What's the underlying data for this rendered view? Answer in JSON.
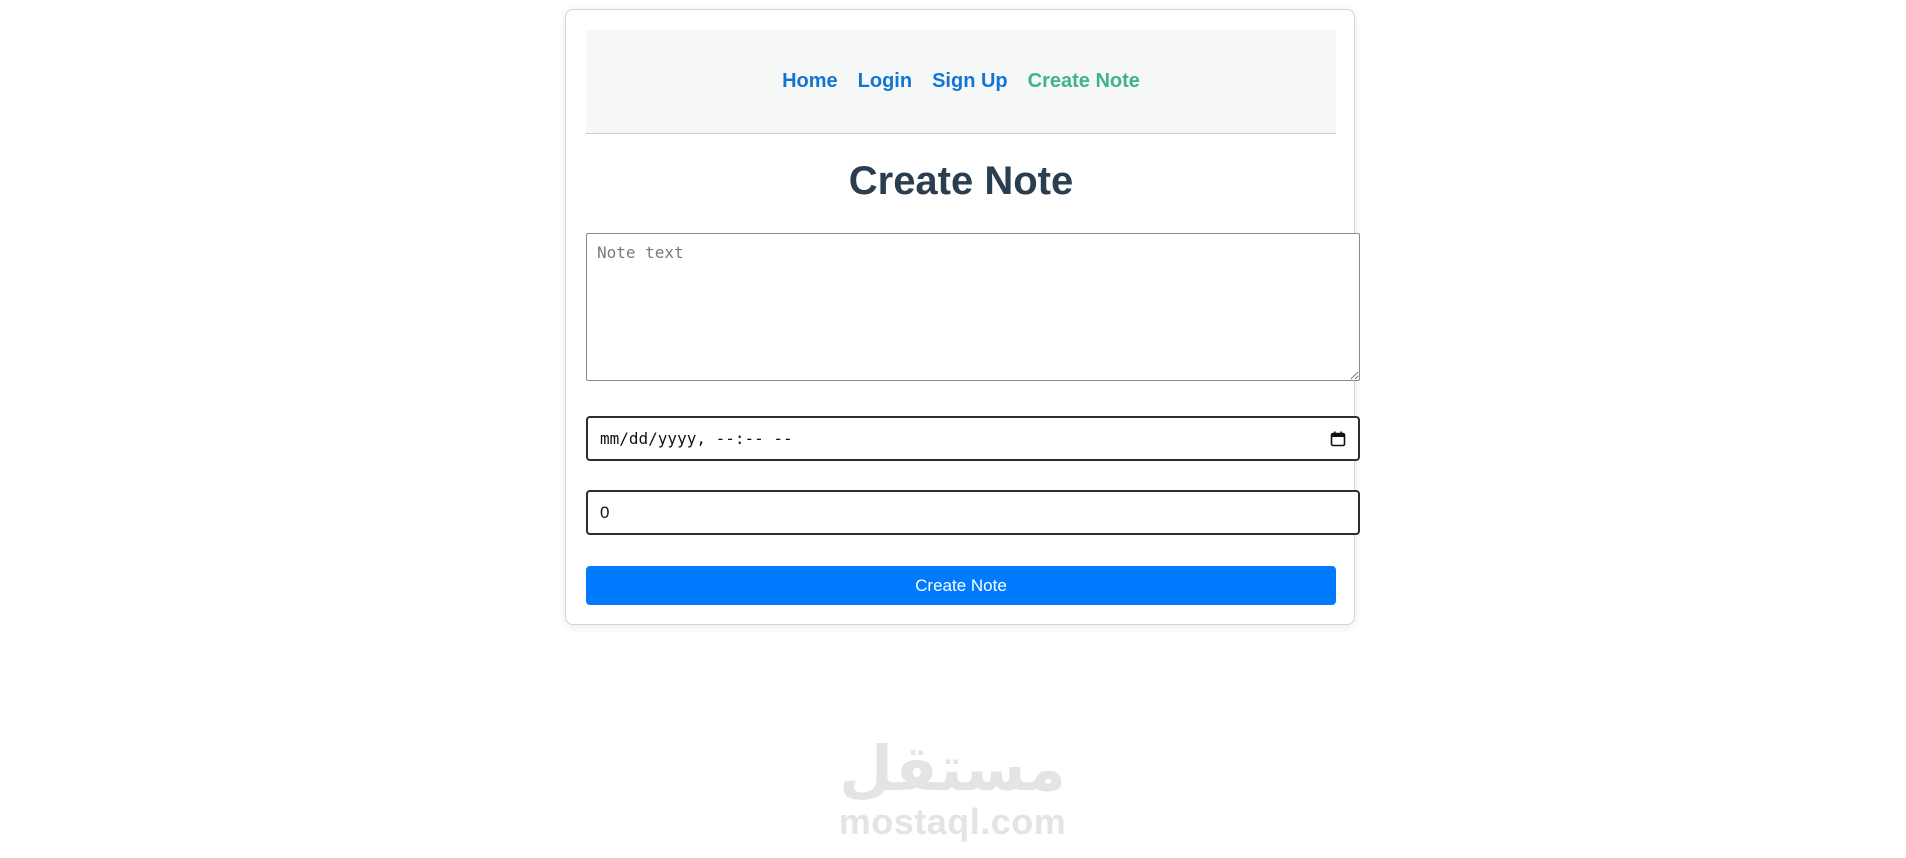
{
  "nav": {
    "items": [
      {
        "label": "Home",
        "active": false
      },
      {
        "label": "Login",
        "active": false
      },
      {
        "label": "Sign Up",
        "active": false
      },
      {
        "label": "Create Note",
        "active": true
      }
    ]
  },
  "page": {
    "title": "Create Note"
  },
  "form": {
    "note_placeholder": "Note text",
    "note_value": "",
    "datetime_value": "mm/dd/yyyy, --:-- --",
    "number_value": "0",
    "submit_label": "Create Note"
  },
  "watermark": {
    "arabic": "مستقل",
    "latin": "mostaql.com"
  },
  "colors": {
    "link": "#1175d6",
    "link_active": "#3fb389",
    "primary_button": "#007bff",
    "title": "#2b3e50"
  },
  "icons": {
    "datetime_picker": "calendar-icon"
  }
}
